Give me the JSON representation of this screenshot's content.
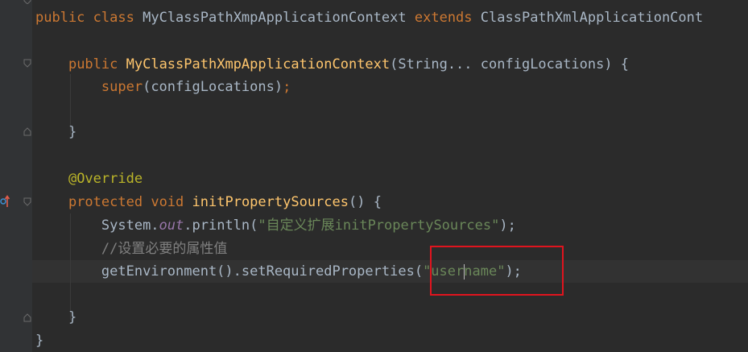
{
  "code": {
    "l1": {
      "kw1": "public",
      "kw2": "class",
      "name": "MyClassPathXmpApplicationContext",
      "kw3": "extends",
      "parent": "ClassPathXmlApplicationCont"
    },
    "l2": {
      "kw1": "public",
      "name": "MyClassPathXmpApplicationContext",
      "open": "(",
      "type": "String",
      "dots": "...",
      "param": "configLocations",
      "close": ") {"
    },
    "l3": {
      "call": "super",
      "args": "(configLocations)",
      "semi": ";"
    },
    "l4": {
      "brace": "}"
    },
    "l5": {
      "annotation": "@Override"
    },
    "l6": {
      "kw1": "protected",
      "kw2": "void",
      "name": "initPropertySources",
      "rest": "() {"
    },
    "l7": {
      "obj": "System.",
      "field": "out",
      "call": ".println(",
      "str": "\"自定义扩展initPropertySources\"",
      "end": ");"
    },
    "l8": {
      "comment": "//设置必要的属性值"
    },
    "l9": {
      "call": "getEnvironment().setRequiredProperties(",
      "str_a": "\"user",
      "str_b": "name\"",
      "end": ");"
    },
    "l10": {
      "brace": "}"
    },
    "l11": {
      "brace": "}"
    }
  },
  "colors": {
    "keyword": "#cc7832",
    "function": "#ffc66d",
    "string": "#6a8759",
    "annotation": "#bbb529",
    "field": "#9876aa",
    "highlight_box": "#e0141e"
  }
}
